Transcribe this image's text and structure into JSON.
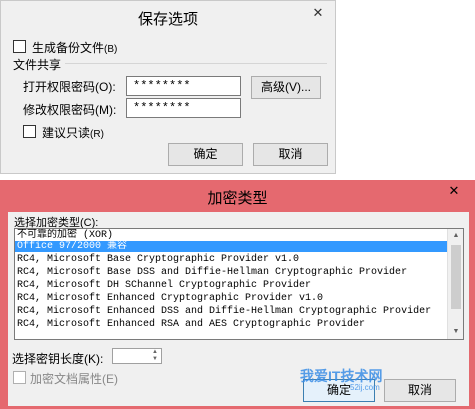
{
  "save_dialog": {
    "title": "保存选项",
    "close_glyph": "✕",
    "backup_label": "生成备份文件",
    "backup_key": "(B)",
    "file_sharing_label": "文件共享",
    "open_pwd_label": "打开权限密码(O):",
    "open_pwd_value": "********",
    "modify_pwd_label": "修改权限密码(M):",
    "modify_pwd_value": "********",
    "advanced_button": "高级(V)...",
    "readonly_label": "建议只读",
    "readonly_key": "(R)",
    "ok_button": "确定",
    "cancel_button": "取消"
  },
  "encrypt_dialog": {
    "title": "加密类型",
    "close_glyph": "✕",
    "list_label": "选择加密类型(C):",
    "items": [
      "不可靠的加密 (XOR)",
      "Office 97/2000 兼容",
      "RC4, Microsoft Base Cryptographic Provider v1.0",
      "RC4, Microsoft Base DSS and Diffie-Hellman Cryptographic Provider",
      "RC4, Microsoft DH SChannel Cryptographic Provider",
      "RC4, Microsoft Enhanced Cryptographic Provider v1.0",
      "RC4, Microsoft Enhanced DSS and Diffie-Hellman Cryptographic Provider",
      "RC4, Microsoft Enhanced RSA and AES Cryptographic Provider"
    ],
    "selected_item": "Office 97/2000 兼容",
    "key_length_label": "选择密钥长度(K):",
    "key_length_value": "",
    "encrypt_props_label": "加密文档属性(E)",
    "ok_button": "确定",
    "cancel_button": "取消"
  },
  "watermark": {
    "text": "我爱IT技术网",
    "subtext": "52ij.com"
  },
  "colors": {
    "dialog_bg": "#f0f0f0",
    "encrypt_titlebar": "#e5696f",
    "selection": "#3399ff",
    "watermark": "#3b8ee6"
  }
}
